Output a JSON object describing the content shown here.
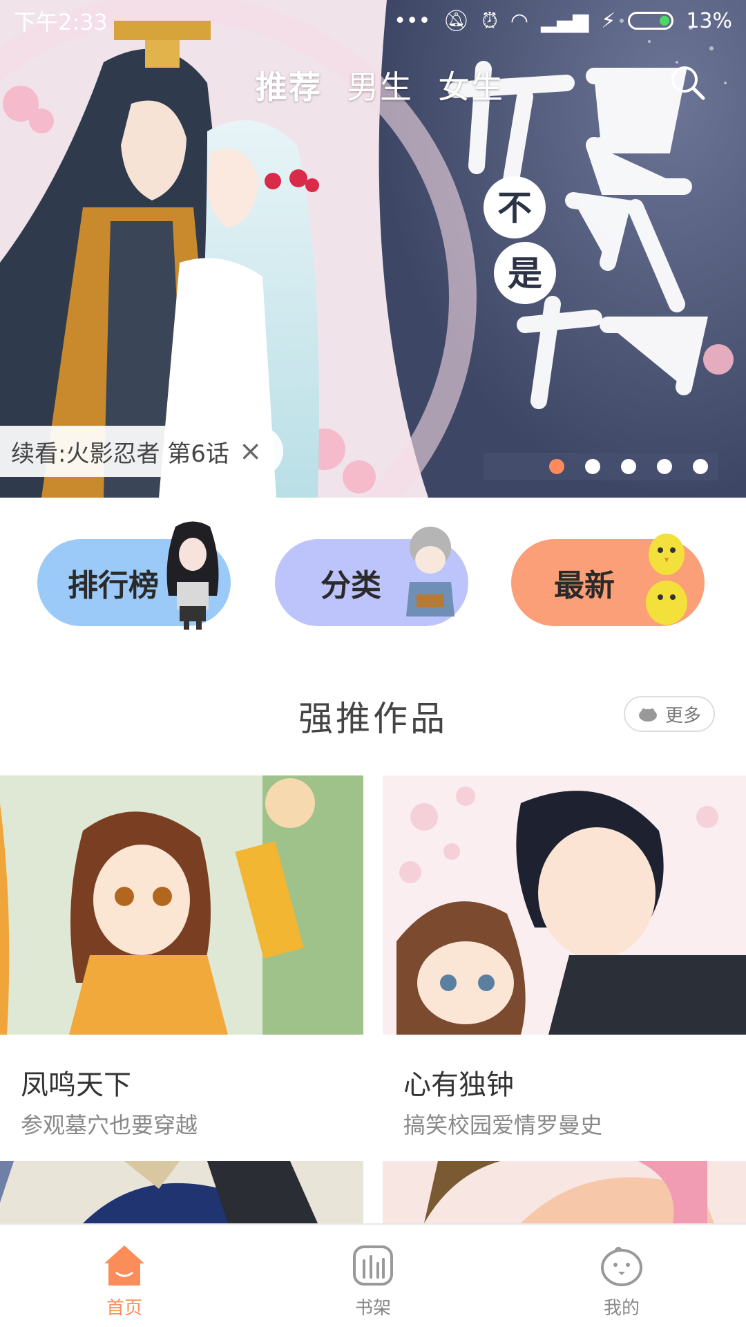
{
  "status_bar": {
    "time": "下午2:33",
    "indicators": "••• ",
    "battery_percent": "13%"
  },
  "top_tabs": [
    {
      "label": "推荐",
      "active": true
    },
    {
      "label": "男生",
      "active": false
    },
    {
      "label": "女生",
      "active": false
    }
  ],
  "banner": {
    "title_art": "妲己不是坏狐狸",
    "continue_reading": "续看:火影忍者 第6话",
    "close_symbol": "×",
    "dot_count": 5,
    "active_dot": 0
  },
  "categories": [
    {
      "label": "排行榜",
      "color": "#9ccaf8"
    },
    {
      "label": "分类",
      "color": "#bcc4fb"
    },
    {
      "label": "最新",
      "color": "#fb9f78"
    }
  ],
  "section": {
    "title": "强推作品",
    "more_label": "更多"
  },
  "cards": [
    {
      "title": "凤鸣天下",
      "desc": "参观墓穴也要穿越"
    },
    {
      "title": "心有独钟",
      "desc": "搞笑校园爱情罗曼史"
    }
  ],
  "bottom_nav": [
    {
      "label": "首页",
      "icon": "home-icon",
      "active": true
    },
    {
      "label": "书架",
      "icon": "bookshelf-icon",
      "active": false
    },
    {
      "label": "我的",
      "icon": "profile-icon",
      "active": false
    }
  ],
  "colors": {
    "accent": "#fb8d5a",
    "dot_active": "#ff8a5c"
  }
}
